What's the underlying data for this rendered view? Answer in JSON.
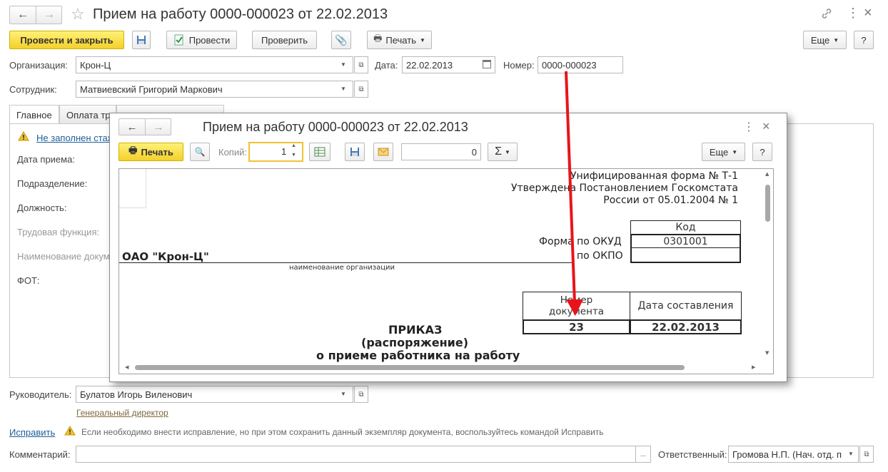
{
  "window": {
    "title": "Прием на работу 0000-000023 от 22.02.2013",
    "toolbar": {
      "post_close": "Провести и закрыть",
      "post": "Провести",
      "check": "Проверить",
      "print": "Печать",
      "more": "Еще",
      "help": "?"
    },
    "header": {
      "org_label": "Организация:",
      "org_value": "Крон-Ц",
      "date_label": "Дата:",
      "date_value": "22.02.2013",
      "number_label": "Номер:",
      "number_value": "0000-000023",
      "employee_label": "Сотрудник:",
      "employee_value": "Матвиевский Григорий Маркович"
    },
    "tabs": [
      "Главное",
      "Оплата тр"
    ],
    "main": {
      "warning": "Не заполнен стаж",
      "fields": [
        "Дата приема:",
        "Подразделение:",
        "Должность:",
        "Трудовая функция:",
        "Наименование документа:",
        "ФОТ:"
      ]
    },
    "footer": {
      "manager_label": "Руководитель:",
      "manager_value": "Булатов Игорь Виленович",
      "manager_position": "Генеральный директор",
      "fix_link": "Исправить",
      "fix_hint": "Если необходимо внести исправление, но при этом сохранить данный экземпляр документа, воспользуйтесь командой Исправить",
      "comment_label": "Комментарий:",
      "comment_button": "...",
      "responsible_label": "Ответственный:",
      "responsible_value": "Громова Н.П. (Нач. отд. п"
    }
  },
  "print_dialog": {
    "title": "Прием на работу 0000-000023 от 22.02.2013",
    "print_button": "Печать",
    "copies_label": "Копий:",
    "copies_value": "1",
    "sum_value": "0",
    "sum_symbol": "Σ",
    "more": "Еще",
    "help": "?",
    "more_icon": "⋮",
    "close_icon": "×",
    "form": {
      "header_line1": "Унифицированная форма № Т-1",
      "header_line2": "Утверждена Постановлением Госкомстата",
      "header_line3": "России от 05.01.2004 № 1",
      "code_header": "Код",
      "okud_label": "Форма по ОКУД",
      "okud_value": "0301001",
      "okpo_label": "по ОКПО",
      "okpo_value": "",
      "org_name": "ОАО \"Крон-Ц\"",
      "org_caption": "наименование организации",
      "doc_number_header": "Номер документа",
      "doc_date_header": "Дата составления",
      "doc_number_value": "23",
      "doc_date_value": "22.02.2013",
      "order_line1": "ПРИКАЗ",
      "order_line2": "(распоряжение)",
      "order_line3": "о приеме работника на работу"
    }
  },
  "colors": {
    "accent_yellow": "#f4d02a",
    "link_blue": "#1c5e99",
    "arrow_red": "#e8141b",
    "warning_yellow": "#f2c230"
  }
}
